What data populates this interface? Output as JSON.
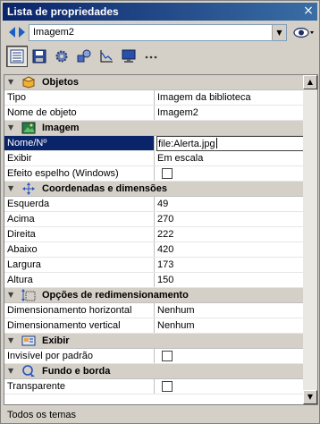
{
  "window": {
    "title": "Lista de propriedades",
    "close_glyph": "×"
  },
  "selector": {
    "value": "Imagem2"
  },
  "toolbar": {
    "buttons": [
      "list-icon",
      "floppy-icon",
      "gear-icon",
      "shapes-icon",
      "chart-icon",
      "monitor-icon",
      "more-icon"
    ],
    "active_index": 0
  },
  "grid": {
    "categories": {
      "objetos": "Objetos",
      "imagem": "Imagem",
      "coords": "Coordenadas e dimensões",
      "redim": "Opções de redimensionamento",
      "exibir": "Exibir",
      "fundo": "Fundo e borda"
    },
    "props": {
      "tipo": {
        "name": "Tipo",
        "value": "Imagem da biblioteca"
      },
      "nome_objeto": {
        "name": "Nome de objeto",
        "value": "Imagem2"
      },
      "nome_n": {
        "name": "Nome/Nº",
        "value": "file:Alerta.jpg"
      },
      "exibir": {
        "name": "Exibir",
        "value": "Em escala"
      },
      "efeito_espelho": {
        "name": "Efeito espelho (Windows)",
        "checked": false
      },
      "esquerda": {
        "name": "Esquerda",
        "value": "49"
      },
      "acima": {
        "name": "Acima",
        "value": "270"
      },
      "direita": {
        "name": "Direita",
        "value": "222"
      },
      "abaixo": {
        "name": "Abaixo",
        "value": "420"
      },
      "largura": {
        "name": "Largura",
        "value": "173"
      },
      "altura": {
        "name": "Altura",
        "value": "150"
      },
      "dim_horiz": {
        "name": "Dimensionamento horizontal",
        "value": "Nenhum"
      },
      "dim_vert": {
        "name": "Dimensionamento vertical",
        "value": "Nenhum"
      },
      "invisivel": {
        "name": "Invisível por padrão",
        "checked": false
      },
      "transparente": {
        "name": "Transparente",
        "checked": false
      }
    }
  },
  "status": {
    "text": "Todos os temas"
  },
  "colors": {
    "title_bar": "#0a246a",
    "selection": "#0a246a",
    "face": "#d4d0c8"
  }
}
